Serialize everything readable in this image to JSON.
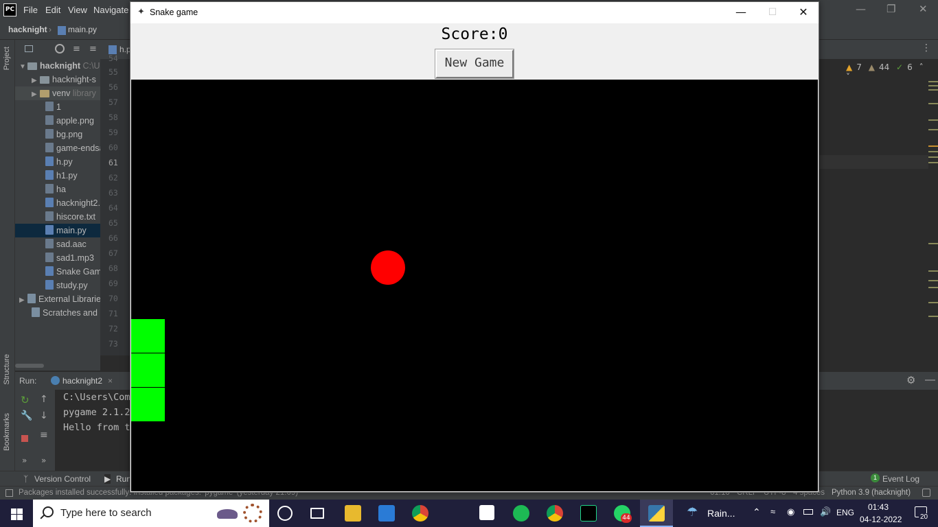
{
  "ide": {
    "logo": "PC",
    "menu": [
      "File",
      "Edit",
      "View",
      "Navigate"
    ],
    "breadcrumbs": {
      "project": "hacknight",
      "file": "main.py"
    },
    "editor_tab_partial": "h.p",
    "side_tabs": {
      "project": "Project",
      "structure": "Structure",
      "bookmarks": "Bookmarks"
    },
    "project_tree": {
      "root": "hacknight",
      "root_path": "C:\\U",
      "items": [
        {
          "label": "hacknight-s",
          "kind": "folder"
        },
        {
          "label": "venv",
          "suffix": "library",
          "kind": "folder"
        },
        {
          "label": "1",
          "kind": "file"
        },
        {
          "label": "apple.png",
          "kind": "file"
        },
        {
          "label": "bg.png",
          "kind": "file"
        },
        {
          "label": "game-endsa",
          "kind": "file"
        },
        {
          "label": "h.py",
          "kind": "py"
        },
        {
          "label": "h1.py",
          "kind": "py"
        },
        {
          "label": "ha",
          "kind": "file"
        },
        {
          "label": "hacknight2.",
          "kind": "py"
        },
        {
          "label": "hiscore.txt",
          "kind": "file"
        },
        {
          "label": "main.py",
          "kind": "py",
          "selected": true
        },
        {
          "label": "sad.aac",
          "kind": "file"
        },
        {
          "label": "sad1.mp3",
          "kind": "file"
        },
        {
          "label": "Snake Game",
          "kind": "py"
        },
        {
          "label": "study.py",
          "kind": "py"
        },
        {
          "label": "External Librarie",
          "kind": "lib"
        },
        {
          "label": "Scratches and C",
          "kind": "scratch"
        }
      ]
    },
    "line_numbers": [
      "54",
      "55",
      "56",
      "57",
      "58",
      "59",
      "60",
      "61",
      "62",
      "63",
      "64",
      "65",
      "66",
      "67",
      "68",
      "69",
      "70",
      "71",
      "72",
      "73"
    ],
    "current_line": "61",
    "inspections": {
      "warnings": "7",
      "weak_warnings": "44",
      "ok": "6"
    },
    "run": {
      "label": "Run:",
      "config": "hacknight2",
      "output": [
        "C:\\Users\\Com",
        "pygame 2.1.2",
        "Hello from t"
      ]
    },
    "bottom_tabs": {
      "version_control": "Version Control",
      "run": "Run",
      "event_log": "Event Log",
      "event_log_count": "1"
    },
    "status": {
      "message": "Packages installed successfully: Installed packages: 'pygame' (yesterday 21:09)",
      "position": "61:10",
      "line_sep": "CRLF",
      "encoding": "UTF-8",
      "indent": "4 spaces",
      "interpreter": "Python 3.9 (hacknight)"
    }
  },
  "game": {
    "window_title": "Snake game",
    "score_text": "Score:0",
    "new_game_label": "New Game",
    "snake_color": "#00ff00",
    "apple_color": "#ff0000",
    "snake_length": 3
  },
  "taskbar": {
    "search_placeholder": "Type here to search",
    "weather": "Rain...",
    "language": "ENG",
    "time": "01:43",
    "date": "04-12-2022",
    "notifications": "20",
    "whatsapp_badge": "44"
  }
}
